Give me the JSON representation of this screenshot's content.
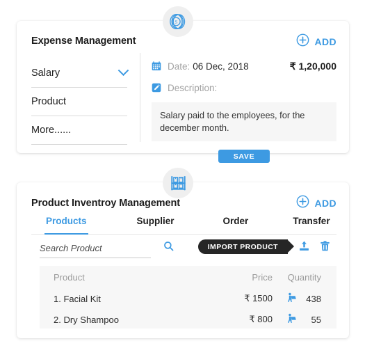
{
  "expense_card": {
    "badge_icon": "coin-stack-icon",
    "title": "Expense Management",
    "add_button": {
      "label": "ADD",
      "icon": "plus-circle-icon"
    },
    "categories": [
      {
        "label": "Salary",
        "selected": true,
        "icon": "chevron-down-icon"
      },
      {
        "label": "Product",
        "selected": false
      },
      {
        "label": "More......",
        "selected": false
      }
    ],
    "date": {
      "icon": "calendar-icon",
      "key": "Date:",
      "value": "06 Dec, 2018"
    },
    "amount": "₹ 1,20,000",
    "description": {
      "icon": "pencil-edit-icon",
      "key": "Description:"
    },
    "description_text": "Salary paid to the employees, for the december month.",
    "save_label": "SAVE"
  },
  "inventory_card": {
    "badge_icon": "shelf-rack-icon",
    "title": "Product Inventroy Management",
    "add_button": {
      "label": "ADD",
      "icon": "plus-circle-icon"
    },
    "tabs": [
      {
        "label": "Products",
        "active": true
      },
      {
        "label": "Supplier",
        "active": false
      },
      {
        "label": "Order",
        "active": false
      },
      {
        "label": "Transfer",
        "active": false
      }
    ],
    "search": {
      "placeholder": "Search Product",
      "value": "",
      "icon": "search-icon"
    },
    "import_label": "IMPORT PRODUCT",
    "upload_icon": "upload-icon",
    "delete_icon": "trash-icon",
    "table": {
      "headers": {
        "product": "Product",
        "price": "Price",
        "quantity": "Quantity"
      },
      "rows": [
        {
          "product": "1. Facial Kit",
          "price": "₹ 1500",
          "quantity": "438",
          "qty_icon": "person-cart-icon"
        },
        {
          "product": "2. Dry Shampoo",
          "price": "₹ 800",
          "quantity": "55",
          "qty_icon": "person-cart-icon"
        }
      ]
    }
  },
  "colors": {
    "accent_blue": "#3d9ae2",
    "dark_tag": "#262626",
    "muted_text": "#9b9b9b",
    "panel_bg": "#f7f7f7",
    "badge_bg": "#efefef"
  }
}
